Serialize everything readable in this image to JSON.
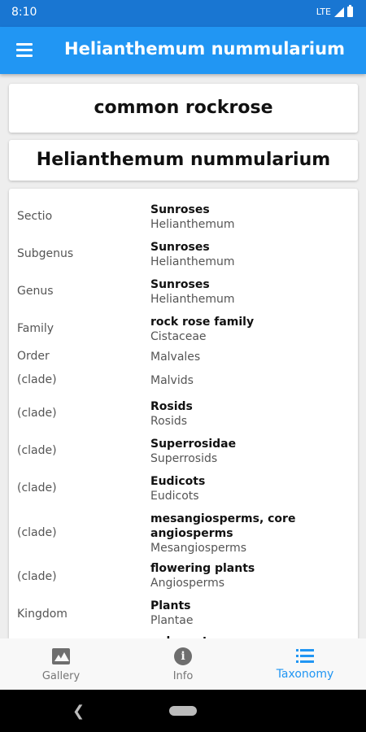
{
  "status_bar": {
    "time": "8:10",
    "network": "LTE"
  },
  "app_bar": {
    "title": "Helianthemum nummularium"
  },
  "species": {
    "common_name": "common rockrose",
    "scientific_name": "Helianthemum nummularium"
  },
  "taxonomy": [
    {
      "rank": "Sectio",
      "common": "Sunroses",
      "scientific": "Helianthemum"
    },
    {
      "rank": "Subgenus",
      "common": "Sunroses",
      "scientific": "Helianthemum"
    },
    {
      "rank": "Genus",
      "common": "Sunroses",
      "scientific": "Helianthemum"
    },
    {
      "rank": "Family",
      "common": "rock rose family",
      "scientific": "Cistaceae"
    },
    {
      "rank": "Order",
      "common": "",
      "scientific": "Malvales"
    },
    {
      "rank": "(clade)",
      "common": "",
      "scientific": "Malvids"
    },
    {
      "rank": "(clade)",
      "common": "Rosids",
      "scientific": "Rosids"
    },
    {
      "rank": "(clade)",
      "common": "Superrosidae",
      "scientific": "Superrosids"
    },
    {
      "rank": "(clade)",
      "common": "Eudicots",
      "scientific": "Eudicots"
    },
    {
      "rank": "(clade)",
      "common": "mesangiosperms, core angiosperms",
      "scientific": "Mesangiosperms"
    },
    {
      "rank": "(clade)",
      "common": "flowering plants",
      "scientific": "Angiosperms"
    },
    {
      "rank": "Kingdom",
      "common": "Plants",
      "scientific": "Plantae"
    },
    {
      "rank": "",
      "common": "eukaryotes",
      "scientific": ""
    }
  ],
  "bottom_nav": {
    "items": [
      {
        "label": "Gallery",
        "icon": "gallery-icon",
        "active": false
      },
      {
        "label": "Info",
        "icon": "info-icon",
        "active": false
      },
      {
        "label": "Taxonomy",
        "icon": "list-icon",
        "active": true
      }
    ]
  },
  "colors": {
    "primary": "#2196f3",
    "status_bar": "#1976d2"
  }
}
